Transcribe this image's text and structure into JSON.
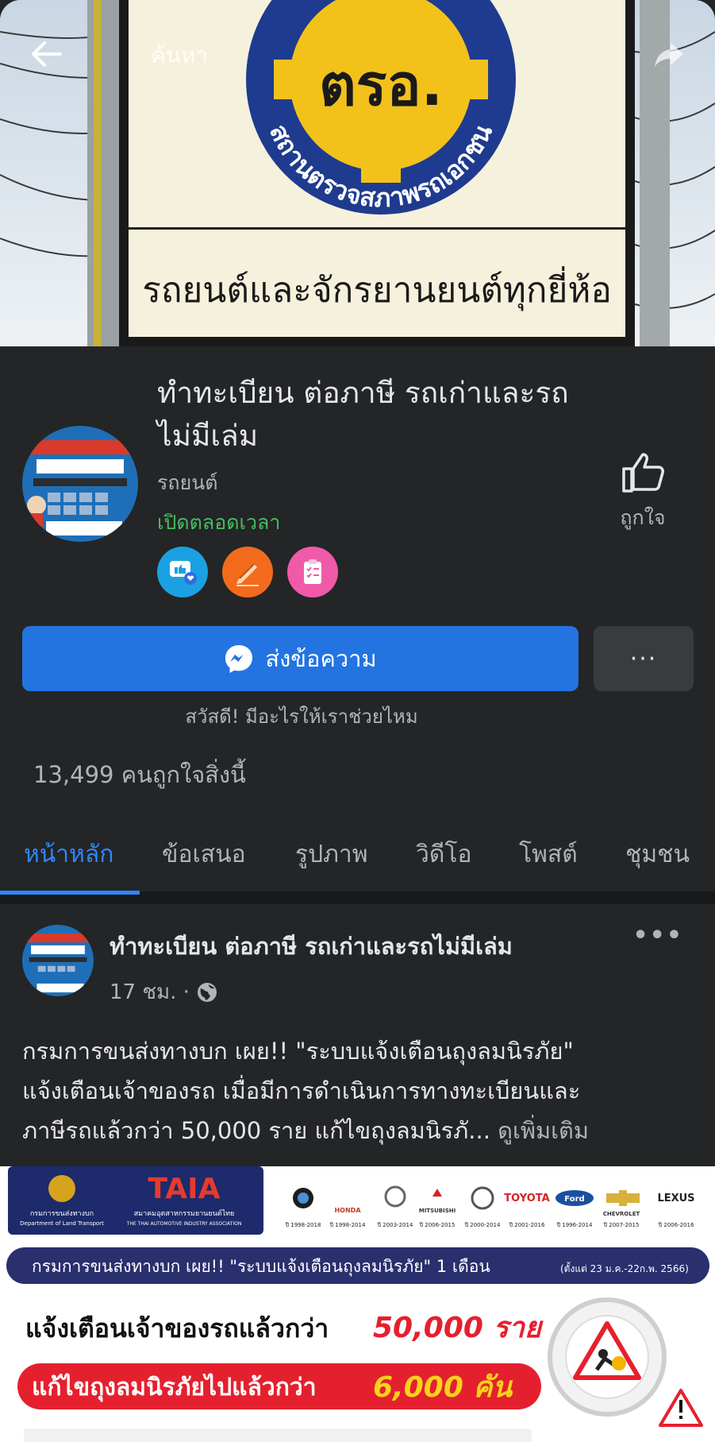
{
  "cover": {
    "sign_logo_text": "ตรอ.",
    "sign_arc_text": "สถานตรวจสภาพรถเอกชน",
    "sign_bottom_text": "รถยนต์และจักรยานยนต์ทุกยี่ห้อ"
  },
  "topbar": {
    "search_hint": "ค้นหา"
  },
  "page": {
    "name": "ทำทะเบียน ต่อภาษี รถเก่าและรถไม่มีเล่ม",
    "category": "รถยนต์",
    "open_status": "เปิดตลอดเวลา",
    "like_label": "ถูกใจ",
    "message_button": "ส่งข้อความ",
    "more_button": "···",
    "greeting": "สวัสดี! มีอะไรให้เราช่วยไหม",
    "likes_count": "13,499 คนถูกใจสิ่งนี้"
  },
  "tabs": [
    {
      "label": "หน้าหลัก",
      "active": true
    },
    {
      "label": "ข้อเสนอ",
      "active": false
    },
    {
      "label": "รูปภาพ",
      "active": false
    },
    {
      "label": "วิดีโอ",
      "active": false
    },
    {
      "label": "โพสต์",
      "active": false
    },
    {
      "label": "ชุมชน",
      "active": false
    }
  ],
  "post": {
    "author": "ทำทะเบียน ต่อภาษี รถเก่าและรถไม่มีเล่ม",
    "time": "17 ชม. ·",
    "line1": "กรมการขนส่งทางบก เผย!! \"ระบบแจ้งเตือนถุงลมนิรภัย\"",
    "line2": "แจ้งเตือนเจ้าของรถ เมื่อมีการดำเนินการทางทะเบียนและ",
    "line3": "ภาษีรถแล้วกว่า 50,000 ราย แก้ไขถุงลมนิรภั...",
    "see_more": "ดูเพิ่มเติม"
  },
  "post_image": {
    "dlt_label": "กรมการขนส่งทางบก",
    "dlt_label_en": "Department of Land Transport",
    "taia_label": "TAIA",
    "taia_label_th": "สมาคมอุตสาหกรรมยานยนต์ไทย",
    "taia_label_en": "THE THAI AUTOMOTIVE INDUSTRY ASSOCIATION",
    "brands": [
      "BMW",
      "HONDA",
      "MAZDA",
      "MITSUBISHI",
      "NISSAN",
      "TOYOTA",
      "Ford",
      "CHEVROLET",
      "LEXUS"
    ],
    "brand_years": [
      "ปี 1998-2018",
      "ปี 1998-2014",
      "ปี 2003-2014",
      "ปี 2006-2015",
      "ปี 2000-2014",
      "ปี 2001-2016",
      "ปี 1996-2014",
      "ปี 2007-2015",
      "ปี 2006-2016"
    ],
    "headline": "กรมการขนส่งทางบก เผย!! \"ระบบแจ้งเตือนถุงลมนิรภัย\" 1 เดือน",
    "headline_period": "(ตั้งแต่ 23 ม.ค.-22ก.พ. 2566)",
    "stat1_prefix": "แจ้งเตือนเจ้าของรถแล้วกว่า",
    "stat1_value": "50,000 ราย",
    "stat2_prefix": "แก้ไขถุงลมนิรภัยไปแล้วกว่า",
    "stat2_value": "6,000 คัน"
  },
  "colors": {
    "background": "#242526",
    "accent": "#2374e1",
    "tab_active": "#2d88ff",
    "open_status": "#45bd62",
    "secondary_text": "#b0b3b8"
  }
}
